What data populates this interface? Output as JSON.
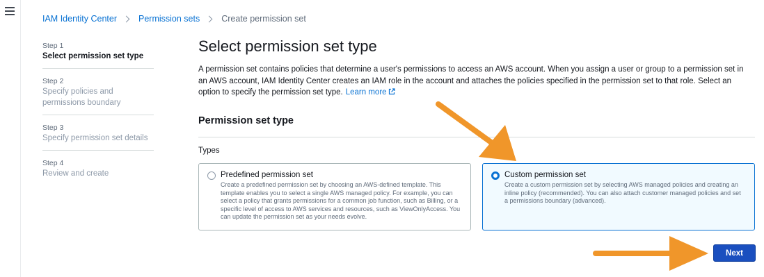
{
  "breadcrumb": {
    "items": [
      "IAM Identity Center",
      "Permission sets",
      "Create permission set"
    ]
  },
  "steps": [
    {
      "number": "Step 1",
      "title": "Select permission set type",
      "active": true
    },
    {
      "number": "Step 2",
      "title": "Specify policies and permissions boundary",
      "active": false
    },
    {
      "number": "Step 3",
      "title": "Specify permission set details",
      "active": false
    },
    {
      "number": "Step 4",
      "title": "Review and create",
      "active": false
    }
  ],
  "main": {
    "title": "Select permission set type",
    "description": "A permission set contains policies that determine a user's permissions to access an AWS account. When you assign a user or group to a permission set in an AWS account, IAM Identity Center creates an IAM role in the account and attaches the policies specified in the permission set to that role. Select an option to specify the permission set type.",
    "learn_more": "Learn more",
    "section_title": "Permission set type",
    "types_label": "Types"
  },
  "options": {
    "predefined": {
      "title": "Predefined permission set",
      "description": "Create a predefined permission set by choosing an AWS-defined template. This template enables you to select a single AWS managed policy. For example, you can select a policy that grants permissions for a common job function, such as Billing, or a specific level of access to AWS services and resources, such as ViewOnlyAccess. You can update the permission set as your needs evolve.",
      "selected": false
    },
    "custom": {
      "title": "Custom permission set",
      "description": "Create a custom permission set by selecting AWS managed policies and creating an inline policy (recommended). You can also attach customer managed policies and set a permissions boundary (advanced).",
      "selected": true
    }
  },
  "footer": {
    "next_label": "Next"
  },
  "colors": {
    "link": "#0972d3",
    "primary_button": "#1a4fbf",
    "selected_tile_bg": "#f1faff",
    "annotation_arrow": "#f0962a"
  },
  "icons": [
    "menu-icon",
    "chevron-right-icon",
    "external-link-icon",
    "radio-icon",
    "annotation-arrow"
  ]
}
